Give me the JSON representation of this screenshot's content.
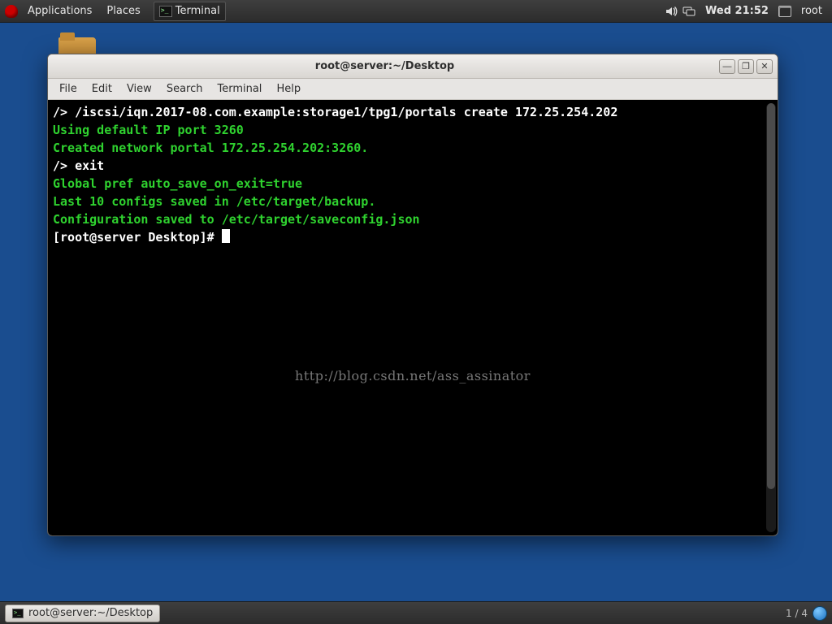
{
  "panel": {
    "applications": "Applications",
    "places": "Places",
    "running_app": "Terminal",
    "clock": "Wed 21:52",
    "user": "root"
  },
  "window": {
    "title": "root@server:~/Desktop",
    "menu": {
      "file": "File",
      "edit": "Edit",
      "view": "View",
      "search": "Search",
      "terminal": "Terminal",
      "help": "Help"
    }
  },
  "terminal": {
    "lines": [
      {
        "cls": "c-white",
        "text": "/> /iscsi/iqn.2017-08.com.example:storage1/tpg1/portals create 172.25.254.202"
      },
      {
        "cls": "c-green",
        "text": "Using default IP port 3260"
      },
      {
        "cls": "c-green",
        "text": "Created network portal 172.25.254.202:3260."
      },
      {
        "cls": "c-white",
        "text": "/> exit"
      },
      {
        "cls": "c-green",
        "text": "Global pref auto_save_on_exit=true"
      },
      {
        "cls": "c-green",
        "text": "Last 10 configs saved in /etc/target/backup."
      },
      {
        "cls": "c-green",
        "text": "Configuration saved to /etc/target/saveconfig.json"
      }
    ],
    "prompt": "[root@server Desktop]# ",
    "watermark": "http://blog.csdn.net/ass_assinator"
  },
  "taskbar": {
    "task_label": "root@server:~/Desktop",
    "workspace": "1 / 4"
  }
}
